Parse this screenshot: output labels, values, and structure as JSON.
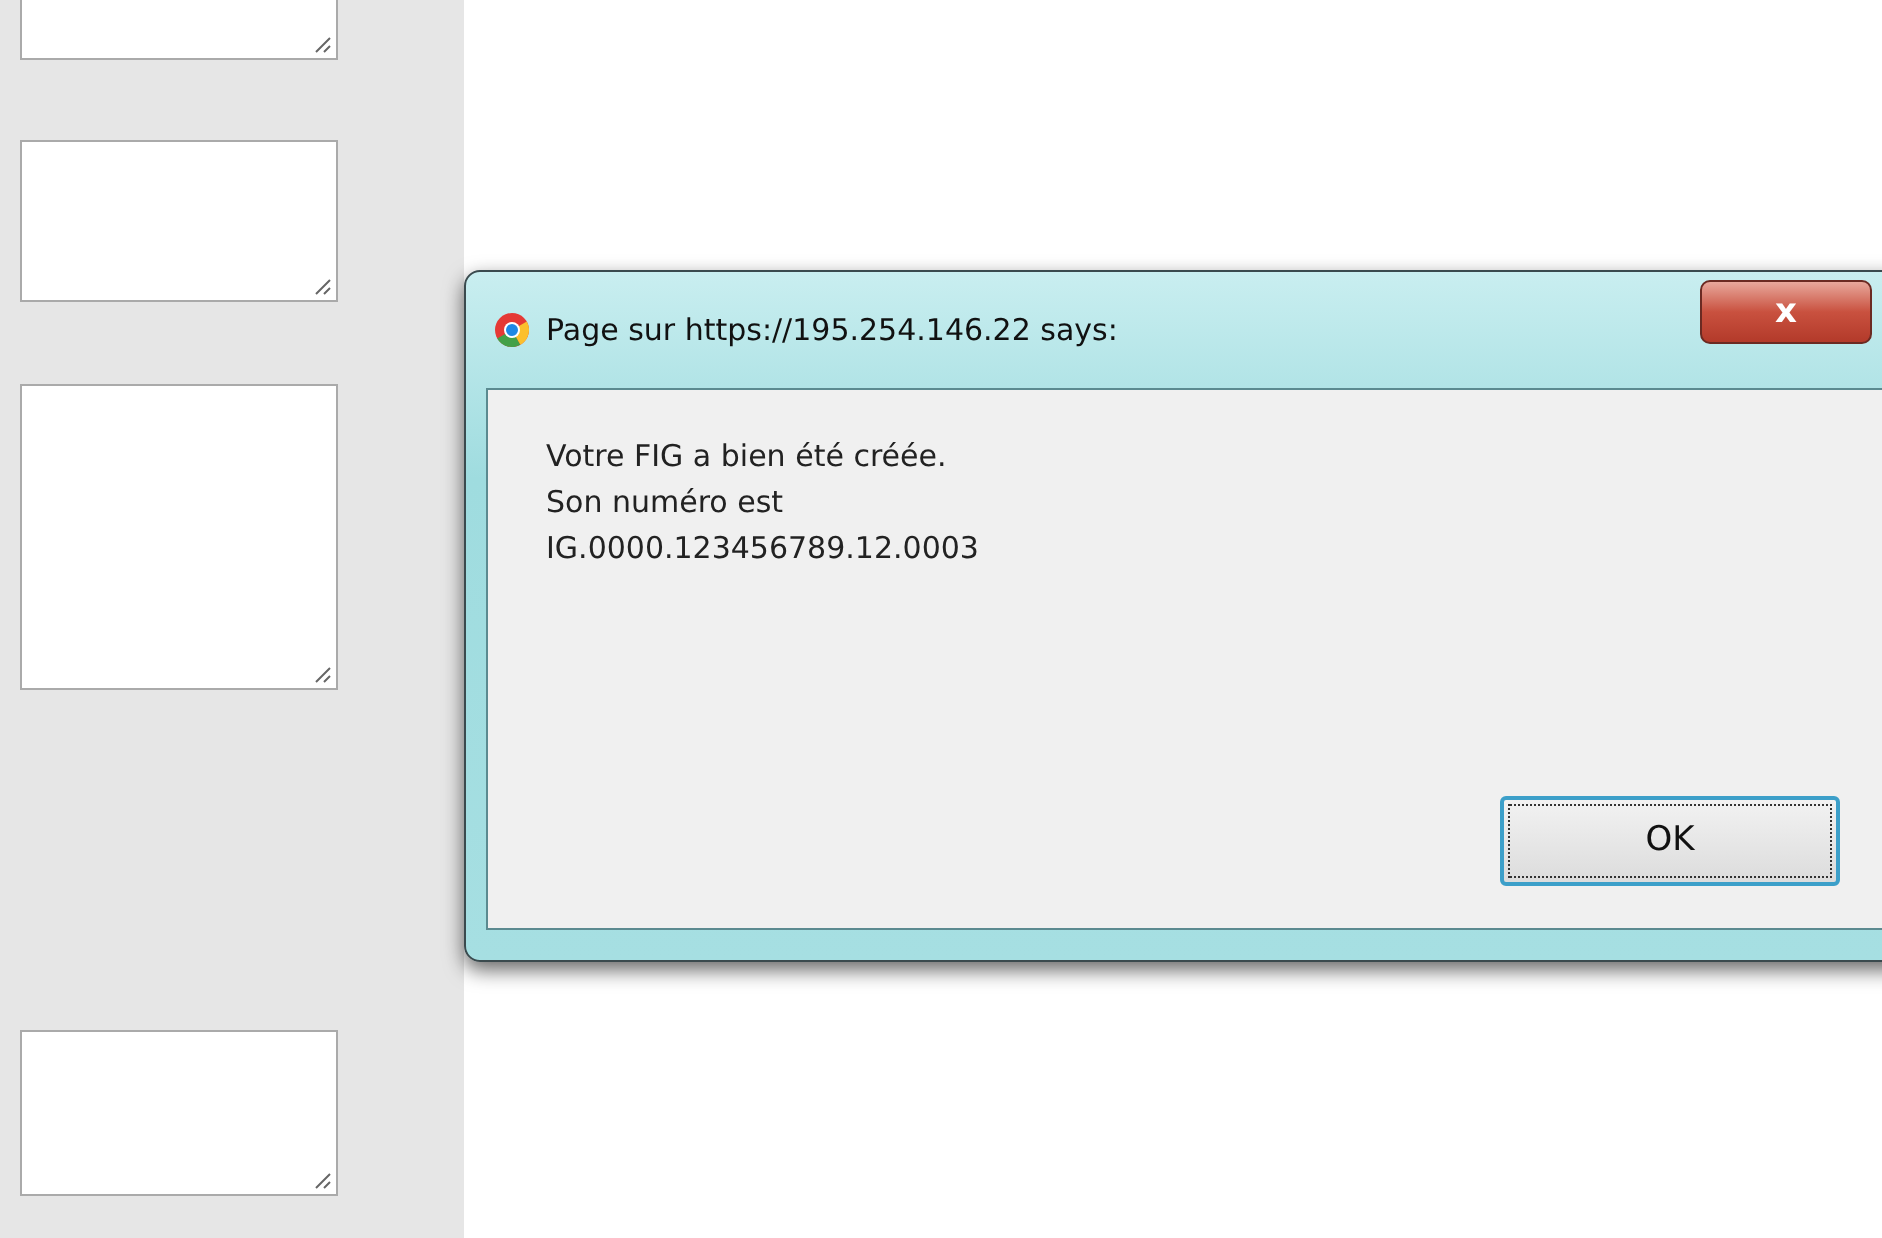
{
  "dialog": {
    "title": "Page sur https://195.254.146.22 says:",
    "message_lines": [
      "Votre FIG a bien été créée.",
      "Son numéro est",
      "IG.0000.123456789.12.0003"
    ],
    "buttons": [
      {
        "label": "OK",
        "focused": true
      }
    ],
    "close_label": "x"
  }
}
